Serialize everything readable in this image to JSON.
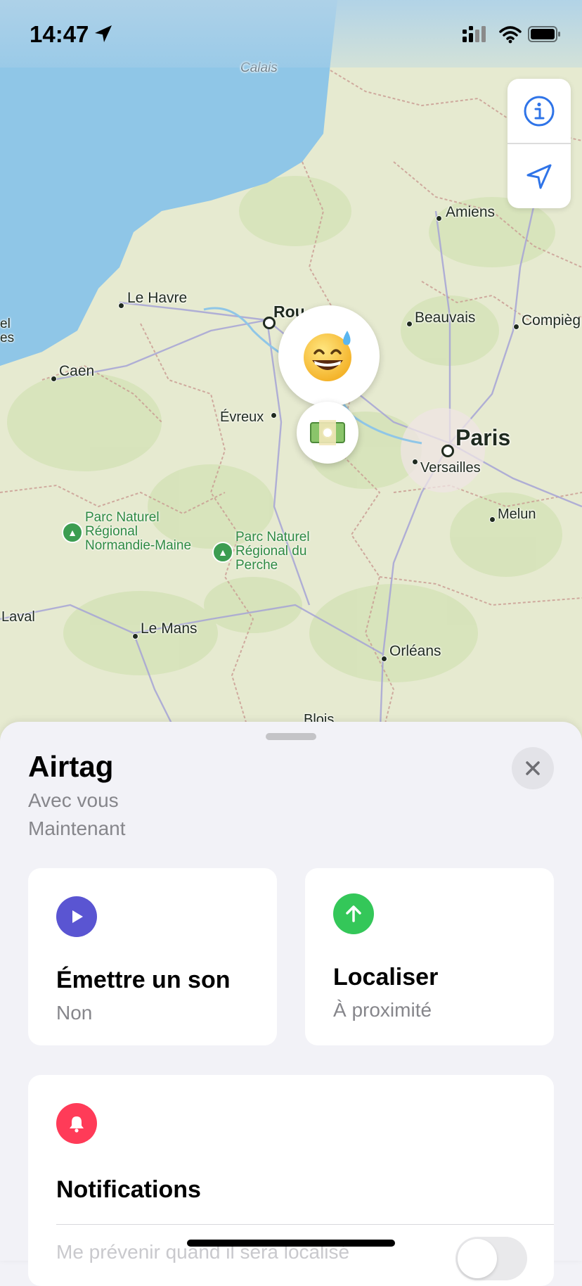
{
  "status_bar": {
    "time": "14:47"
  },
  "map": {
    "water_label": "Calais",
    "cities": {
      "amiens": "Amiens",
      "le_havre": "Le Havre",
      "rouen": "Rou",
      "beauvais": "Beauvais",
      "compiegne": "Compièg",
      "caen": "Caen",
      "evreux": "Évreux",
      "paris": "Paris",
      "versailles": "Versailles",
      "melun": "Melun",
      "laval": "Laval",
      "le_mans": "Le Mans",
      "orleans": "Orléans",
      "blois": "Blois",
      "edge_top": "el",
      "edge_mid": "es"
    },
    "parks": {
      "normandie_maine": "Parc Naturel\nRégional\nNormandie-Maine",
      "perche": "Parc Naturel\nRégional du\nPerche"
    },
    "controls": {
      "info_icon": "info-icon",
      "location_icon": "location-arrow-icon"
    },
    "pins": {
      "item_emoji": "grinning-face-with-sweat",
      "owner_emoji": "money-bag-dollar"
    }
  },
  "sheet": {
    "title": "Airtag",
    "status": "Avec vous",
    "updated": "Maintenant",
    "actions": {
      "play_sound": {
        "title": "Émettre un son",
        "subtitle": "Non",
        "color": "#5a55d2"
      },
      "find": {
        "title": "Localiser",
        "subtitle": "À proximité",
        "color": "#34c759"
      }
    },
    "notifications": {
      "title": "Notifications",
      "color": "#ff3b58",
      "option_label": "Me prévenir quand il sera localisé",
      "option_enabled": false
    }
  }
}
